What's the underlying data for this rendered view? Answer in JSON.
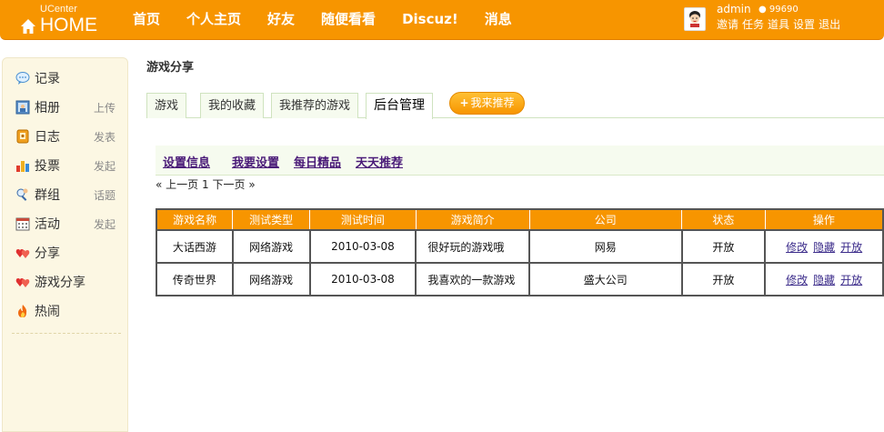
{
  "header": {
    "logo_top": "UCenter",
    "logo_main": "HOME",
    "nav": [
      "首页",
      "个人主页",
      "好友",
      "随便看看",
      "Discuz!",
      "消息"
    ],
    "user": {
      "name": "admin",
      "coins": "99690",
      "links": [
        "邀请",
        "任务",
        "道具",
        "设置",
        "退出"
      ]
    }
  },
  "sidebar": {
    "items": [
      {
        "label": "记录",
        "sub": "",
        "icon": "speech-bubble-icon"
      },
      {
        "label": "相册",
        "sub": "上传",
        "icon": "photo-icon"
      },
      {
        "label": "日志",
        "sub": "发表",
        "icon": "blog-icon"
      },
      {
        "label": "投票",
        "sub": "发起",
        "icon": "poll-icon"
      },
      {
        "label": "群组",
        "sub": "话题",
        "icon": "group-icon"
      },
      {
        "label": "活动",
        "sub": "发起",
        "icon": "calendar-icon"
      },
      {
        "label": "分享",
        "sub": "",
        "icon": "hearts-icon"
      },
      {
        "label": "游戏分享",
        "sub": "",
        "icon": "hearts-icon"
      },
      {
        "label": "热闹",
        "sub": "",
        "icon": "flame-icon"
      }
    ]
  },
  "main": {
    "title": "游戏分享",
    "tabs": [
      "游戏",
      "我的收藏",
      "我推荐的游戏",
      "后台管理"
    ],
    "recommend_button": "我来推荐",
    "subnav": [
      "设置信息",
      "我要设置",
      "每日精品",
      "天天推荐"
    ],
    "pager": {
      "prev": "« 上一页",
      "page": "1",
      "next": "下一页",
      "end": "»"
    },
    "table": {
      "headers": [
        "游戏名称",
        "测试类型",
        "测试时间",
        "游戏简介",
        "公司",
        "状态",
        "操作"
      ],
      "rows": [
        {
          "name": "大话西游",
          "type": "网络游戏",
          "date": "2010-03-08",
          "desc": "很好玩的游戏哦",
          "company": "网易",
          "status": "开放"
        },
        {
          "name": "传奇世界",
          "type": "网络游戏",
          "date": "2010-03-08",
          "desc": "我喜欢的一款游戏",
          "company": "盛大公司",
          "status": "开放"
        }
      ],
      "actions": [
        "修改",
        "隐藏",
        "开放"
      ]
    }
  },
  "colors": {
    "brand_orange": "#f79500",
    "sidebar_bg": "#fcf7e3",
    "tab_green_border": "#cfe3bf",
    "link_purple": "#4a1a78"
  }
}
